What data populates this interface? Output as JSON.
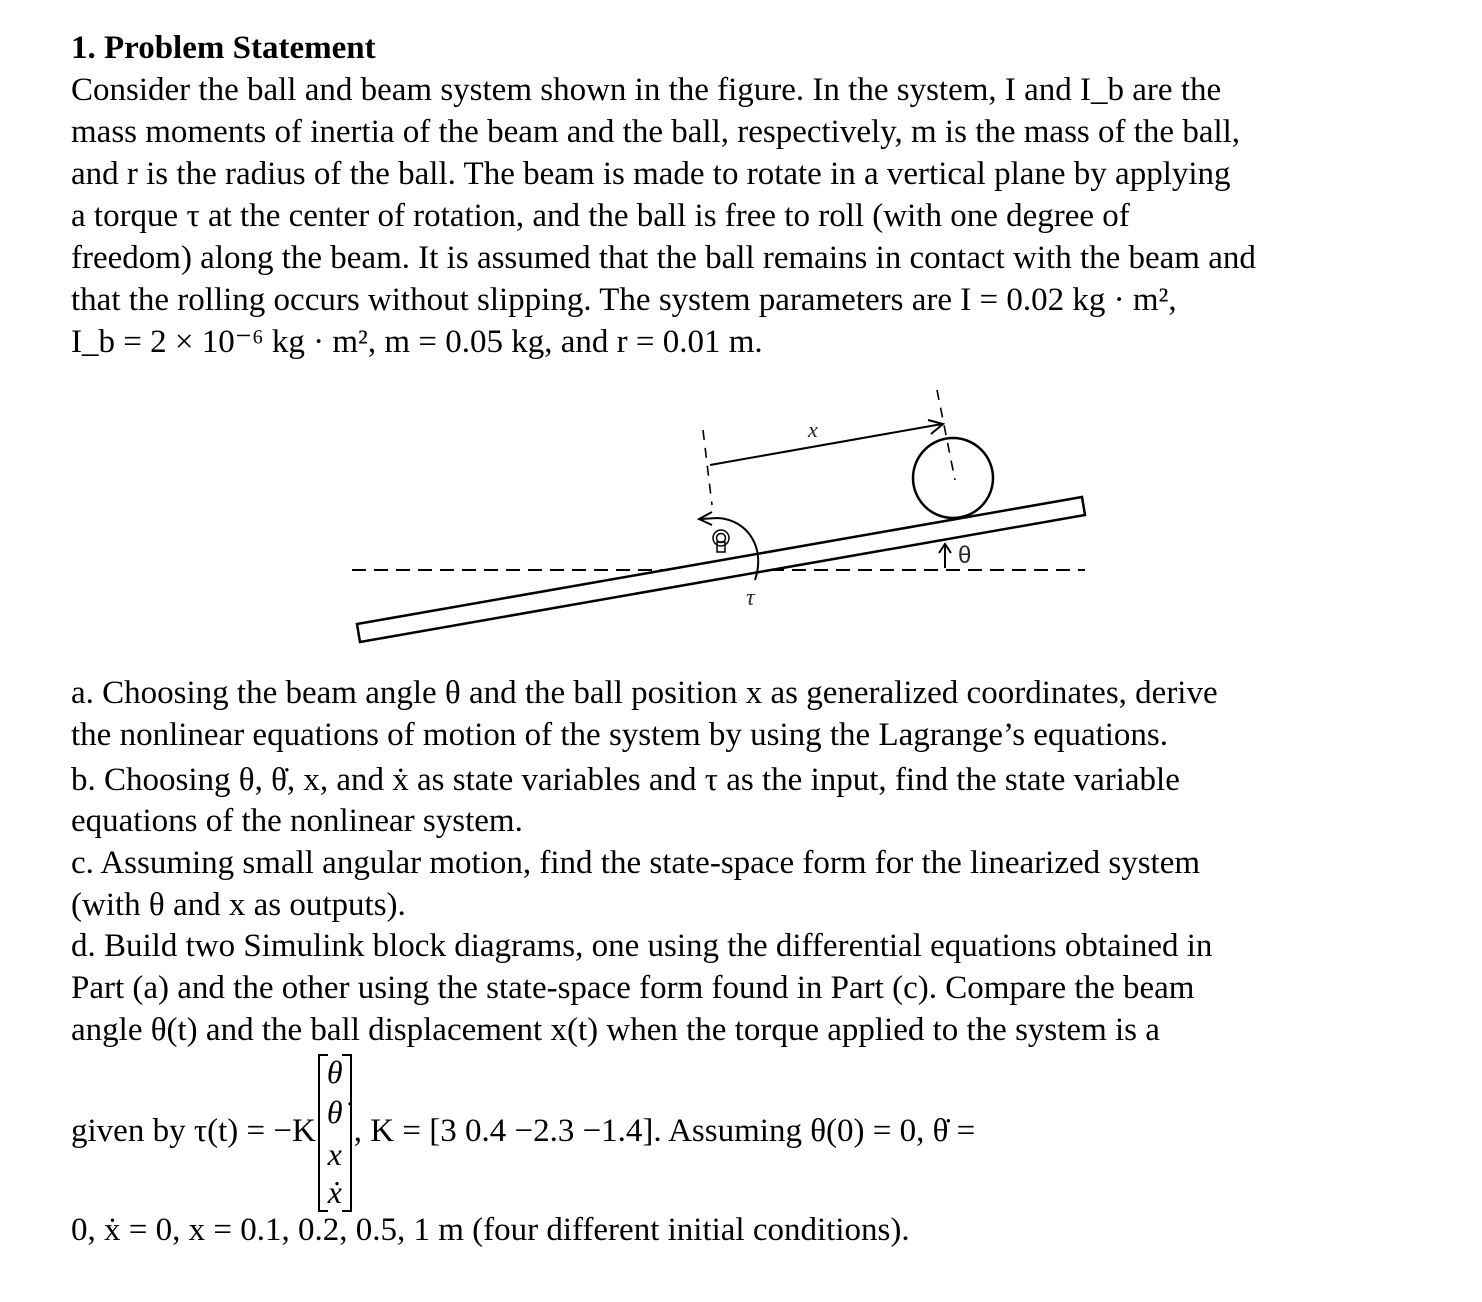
{
  "heading": "1. Problem Statement",
  "paragraph_lines": [
    "Consider the ball and beam system shown in the figure. In the system, I and I_b are the",
    "mass moments of inertia of the beam and the ball, respectively, m is the mass of the ball,",
    "and r is the radius of the ball. The beam is made to rotate in a vertical plane by applying",
    "a torque τ at the center of rotation, and the ball is free to roll (with one degree of",
    "freedom) along the beam. It is assumed that the ball remains in contact with the beam and",
    "that the rolling occurs without slipping. The system parameters are I = 0.02 kg · m²,",
    "I_b = 2 × 10⁻⁶ kg · m², m = 0.05 kg, and r = 0.01 m."
  ],
  "parameters": {
    "I": "0.02 kg·m²",
    "Ib": "2 × 10⁻⁶ kg·m²",
    "m": "0.05 kg",
    "r": "0.01 m"
  },
  "figure": {
    "label_x": "x",
    "label_theta": "θ",
    "label_tau": "τ"
  },
  "parts": {
    "a": [
      "a. Choosing the beam angle θ and the ball position x as generalized coordinates, derive",
      "the nonlinear equations of motion of the system by using the Lagrange’s equations."
    ],
    "b": [
      "b. Choosing θ, θ̇, x, and ẋ as state variables and τ as the input, find the state variable",
      "equations of the nonlinear system."
    ],
    "c": [
      "c. Assuming small angular motion, find the state-space form for the linearized system",
      "(with θ and x as outputs)."
    ],
    "d": [
      "d. Build two Simulink block diagrams, one using the differential equations obtained in",
      "Part (a) and the other using the state-space form found in Part (c). Compare the beam",
      "angle θ(t) and the ball displacement x(t) when the torque applied to the system is a"
    ]
  },
  "control_law": {
    "prefix": "given by τ(t) = −K",
    "state_vector": [
      "θ",
      "θ̇",
      "x",
      "ẋ"
    ],
    "gain_label": ", K = [3   0.4   −2.3   −1.4]. Assuming θ(0) = 0,  θ̇ =",
    "K": [
      3,
      0.4,
      -2.3,
      -1.4
    ],
    "last_line": "0,  ẋ = 0, x = 0.1, 0.2, 0.5, 1 m (four different initial conditions)."
  }
}
